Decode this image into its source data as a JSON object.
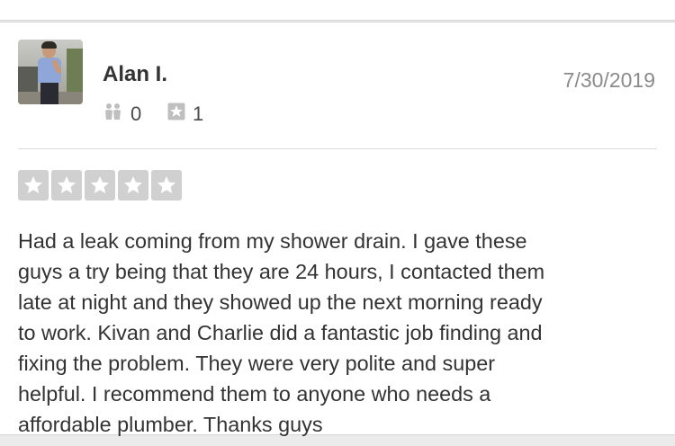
{
  "reviewer": {
    "name": "Alan I.",
    "friends_count": "0",
    "reviews_count": "1"
  },
  "review": {
    "date": "7/30/2019",
    "rating": 5,
    "rating_max": 5,
    "lines": [
      "Had a leak coming from my shower drain. I gave these",
      "guys a try being that they are 24 hours, I contacted them",
      "late at night and they showed up the next morning ready",
      "to work. Kivan and Charlie did a fantastic job finding and",
      "fixing the problem. They were very polite and super",
      "helpful. I recommend them to anyone who needs a",
      "affordable plumber. Thanks guys"
    ]
  },
  "icons": {
    "friends": "friends-icon",
    "reviews": "review-star-icon",
    "rating": "star-icon"
  },
  "colors": {
    "star_box": "#d0d0d0",
    "text": "#333333",
    "date": "#8b8b8b"
  }
}
